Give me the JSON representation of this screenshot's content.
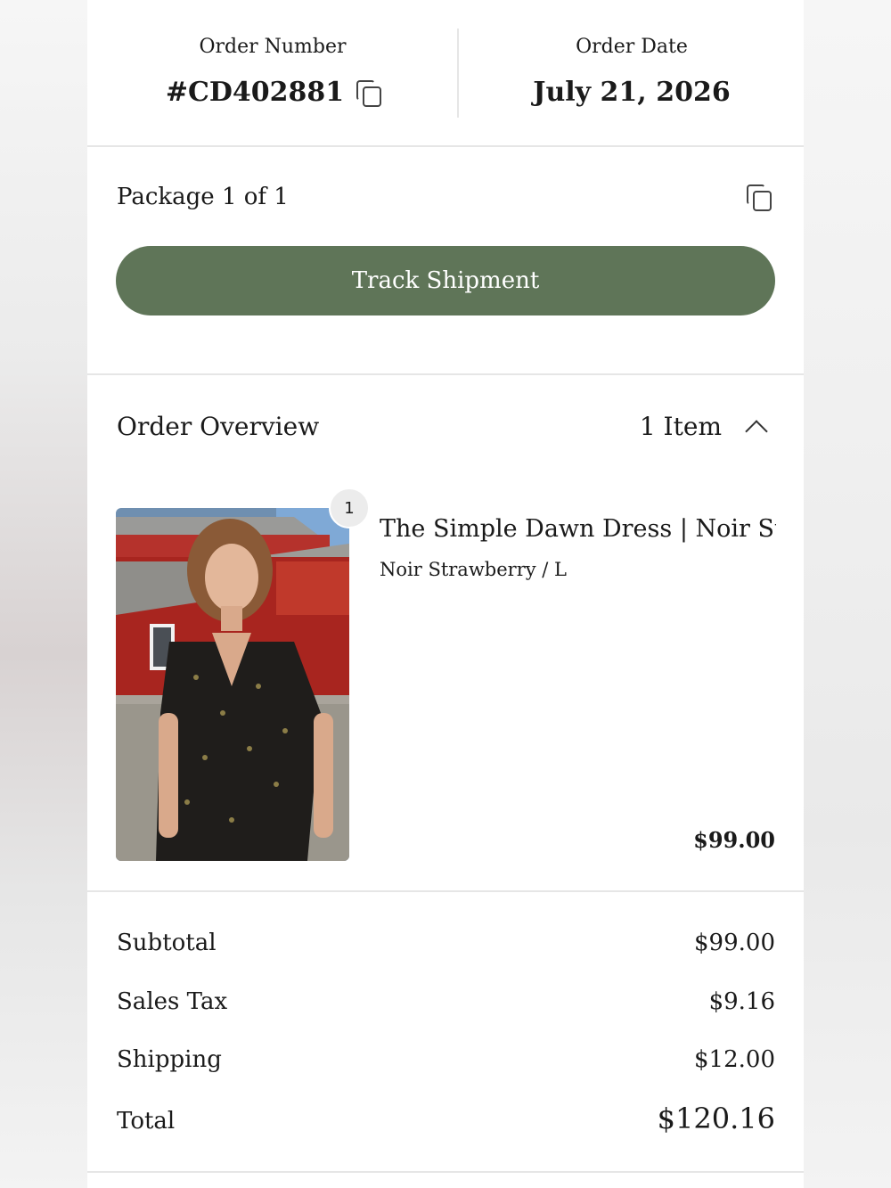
{
  "header": {
    "order_number_label": "Order Number",
    "order_number": "#CD402881",
    "order_date_label": "Order Date",
    "order_date": "July 21, 2026"
  },
  "package": {
    "title": "Package 1 of 1",
    "track_label": "Track Shipment"
  },
  "overview": {
    "title": "Order Overview",
    "item_count": "1 Item",
    "expanded": true
  },
  "items": [
    {
      "quantity": "1",
      "name": "The Simple Dawn Dress | Noir Stra...",
      "variant": "Noir Strawberry / L",
      "price": "$99.00"
    }
  ],
  "summary": {
    "subtotal_label": "Subtotal",
    "subtotal": "$99.00",
    "tax_label": "Sales Tax",
    "tax": "$9.16",
    "shipping_label": "Shipping",
    "shipping": "$12.00",
    "total_label": "Total",
    "total": "$120.16"
  },
  "colors": {
    "accent": "#5f7558",
    "divider": "#e6e6e6"
  },
  "icons": {
    "copy": "copy-icon",
    "collapse": "chevron-up-icon"
  }
}
